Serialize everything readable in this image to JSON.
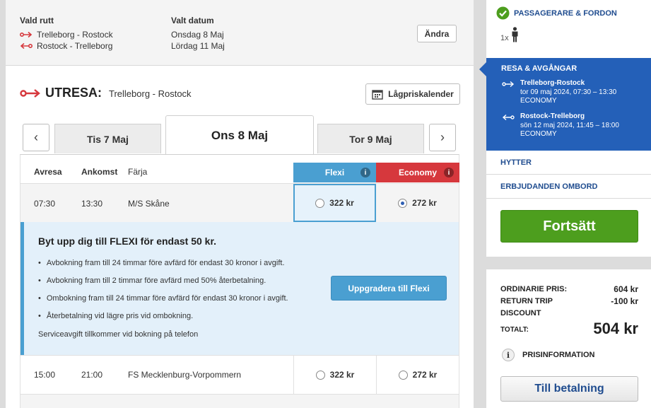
{
  "summary": {
    "route_title": "Vald rutt",
    "route_out": "Trelleborg - Rostock",
    "route_back": "Rostock - Trelleborg",
    "date_title": "Valt datum",
    "date_out": "Onsdag 8 Maj",
    "date_back": "Lördag 11 Maj",
    "change_label": "Ändra"
  },
  "outbound": {
    "label": "UTRESA:",
    "route": "Trelleborg - Rostock",
    "calendar_label": "Lågpriskalender"
  },
  "day_tabs": {
    "prev": "Tis 7 Maj",
    "active": "Ons 8 Maj",
    "next": "Tor 9 Maj"
  },
  "table": {
    "headers": {
      "depart": "Avresa",
      "arrive": "Ankomst",
      "ferry": "Färja",
      "flexi": "Flexi",
      "economy": "Economy"
    },
    "rows": [
      {
        "depart": "07:30",
        "arrive": "13:30",
        "ferry": "M/S Skåne",
        "flexi_price": "322 kr",
        "economy_price": "272 kr"
      },
      {
        "depart": "15:00",
        "arrive": "21:00",
        "ferry": "FS Mecklenburg-Vorpommern",
        "flexi_price": "322 kr",
        "economy_price": "272 kr"
      }
    ]
  },
  "promo": {
    "title": "Byt upp dig till FLEXI för endast 50 kr.",
    "bullets": [
      "Avbokning fram till 24 timmar före avfärd för endast 30 kronor i avgift.",
      "Avbokning fram till 2 timmar före avfärd med 50% återbetalning.",
      "Ombokning fram till 24 timmar före avfärd för endast 30 kronor i avgift.",
      "Återbetalning vid lägre pris vid ombokning."
    ],
    "note": "Serviceavgift tillkommer vid bokning på telefon",
    "upgrade_label": "Uppgradera till Flexi"
  },
  "sidebar": {
    "passengers_title": "PASSAGERARE & FORDON",
    "passenger_count": "1x",
    "trip_title": "RESA & AVGÅNGAR",
    "leg_out": {
      "route": "Trelleborg-Rostock",
      "time": "tor 09 maj 2024, 07:30 – 13:30",
      "fare": "ECONOMY"
    },
    "leg_back": {
      "route": "Rostock-Trelleborg",
      "time": "sön 12 maj 2024, 11:45 – 18:00",
      "fare": "ECONOMY"
    },
    "cabins": "HYTTER",
    "offers": "ERBJUDANDEN OMBORD",
    "continue_label": "Fortsätt"
  },
  "pricing": {
    "ordinary_label": "ORDINARIE PRIS:",
    "ordinary_value": "604 kr",
    "discount_label_1": "RETURN TRIP",
    "discount_label_2": "DISCOUNT",
    "discount_value": "-100 kr",
    "total_label": "TOTALT:",
    "total_value": "504 kr",
    "info_label": "PRISINFORMATION",
    "pay_label": "Till betalning"
  },
  "colors": {
    "flexi": "#4a9fd1",
    "economy": "#d6383d",
    "sidebar_blue": "#2460b8",
    "continue_green": "#4d9e1e"
  }
}
